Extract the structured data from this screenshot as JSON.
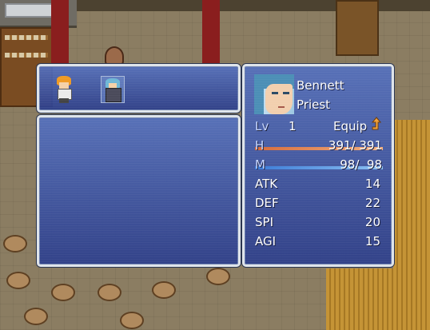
{
  "party": {
    "members": [
      {
        "icon": "hero-sprite-icon"
      },
      {
        "icon": "priest-sprite-icon",
        "selected": true
      }
    ]
  },
  "actor": {
    "name": "Bennett",
    "class": "Priest",
    "portrait_icon": "priest-portrait",
    "lv_label": "Lv",
    "lv": "1",
    "equip_label": "Equip",
    "equip_icon": "up-arrow-icon",
    "hp_label": "H",
    "hp_text": "391/ 391",
    "hp_fraction": 1.0,
    "mp_label": "M",
    "mp_text": "98/  98",
    "mp_fraction": 1.0
  },
  "stats": [
    {
      "label": "ATK",
      "value": "14"
    },
    {
      "label": "DEF",
      "value": "22"
    },
    {
      "label": "SPI",
      "value": "20"
    },
    {
      "label": "AGI",
      "value": "15"
    }
  ],
  "colors": {
    "window_top": "#5470be",
    "window_bottom": "#2c3e8c",
    "hp_gauge": "#d66a3a",
    "mp_gauge": "#3a7ad6",
    "system_text": "#c6d6ff"
  }
}
